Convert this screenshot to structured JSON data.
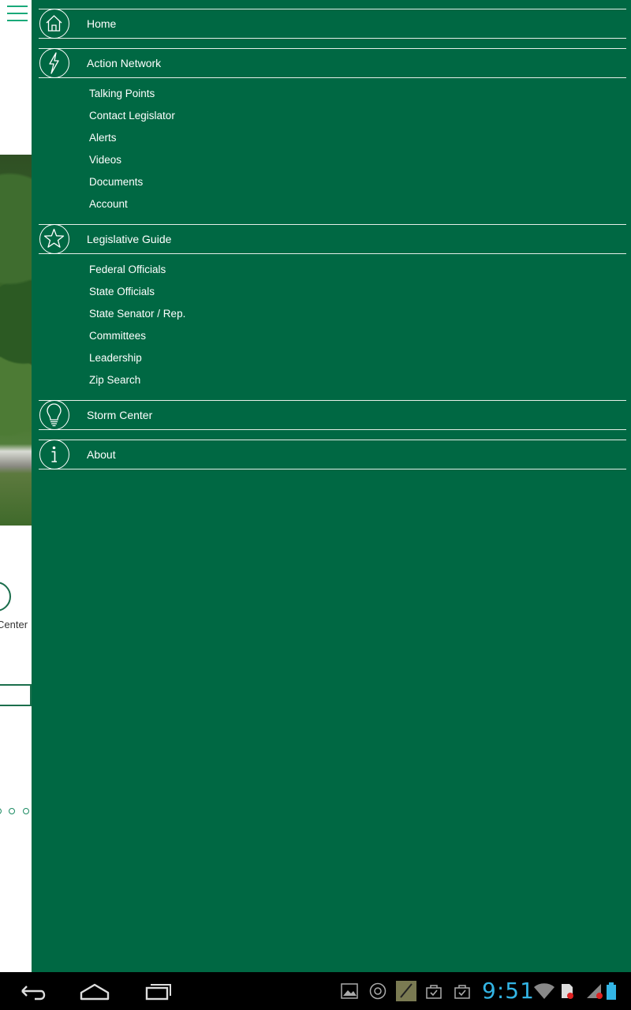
{
  "drawer": {
    "sections": [
      {
        "label": "Home",
        "icon": "home-icon"
      },
      {
        "label": "Action Network",
        "icon": "lightning-icon",
        "items": [
          "Talking Points",
          "Contact Legislator",
          "Alerts",
          "Videos",
          "Documents",
          "Account"
        ]
      },
      {
        "label": "Legislative Guide",
        "icon": "star-icon",
        "items": [
          "Federal Officials",
          "State Officials",
          "State Senator / Rep.",
          "Committees",
          "Leadership",
          "Zip Search"
        ]
      },
      {
        "label": "Storm Center",
        "icon": "lightbulb-icon"
      },
      {
        "label": "About",
        "icon": "info-icon"
      }
    ]
  },
  "background": {
    "partial_label": "Center"
  },
  "status_bar": {
    "time": "9:51"
  },
  "colors": {
    "drawer_bg": "#006843",
    "accent": "#19a979",
    "clock": "#33b5e5"
  }
}
